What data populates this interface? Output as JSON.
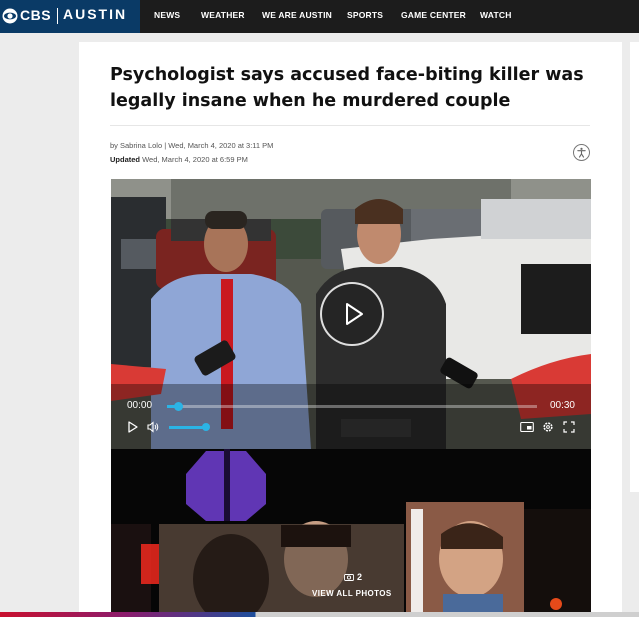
{
  "brand": {
    "network": "CBS",
    "city": "AUSTIN",
    "logo_icon": "cbs-eye-icon",
    "color": "#0a3a66"
  },
  "nav": {
    "items": [
      {
        "label": "NEWS"
      },
      {
        "label": "WEATHER"
      },
      {
        "label": "WE ARE AUSTIN"
      },
      {
        "label": "SPORTS"
      },
      {
        "label": "GAME CENTER"
      },
      {
        "label": "WATCH"
      }
    ]
  },
  "article": {
    "headline_line1": "Psychologist says accused face-biting killer was",
    "headline_line2": "legally insane when he murdered couple",
    "byline": "by Sabrina Lolo | Wed, March 4, 2020 at 3:11 PM",
    "updated_label": "Updated",
    "updated_time": "Wed, March 4, 2020 at 6:59 PM",
    "accessibility_icon": "accessibility-icon"
  },
  "video": {
    "current_time": "00:00",
    "duration": "00:30",
    "progress_fraction": 0.03,
    "volume_fraction": 1.0,
    "accent_color": "#2bb4e6",
    "icons": [
      "play-icon",
      "volume-icon",
      "captions-icon",
      "settings-icon",
      "fullscreen-icon"
    ]
  },
  "gallery": {
    "count": "2",
    "count_icon": "camera-icon",
    "cta": "VIEW ALL PHOTOS"
  }
}
